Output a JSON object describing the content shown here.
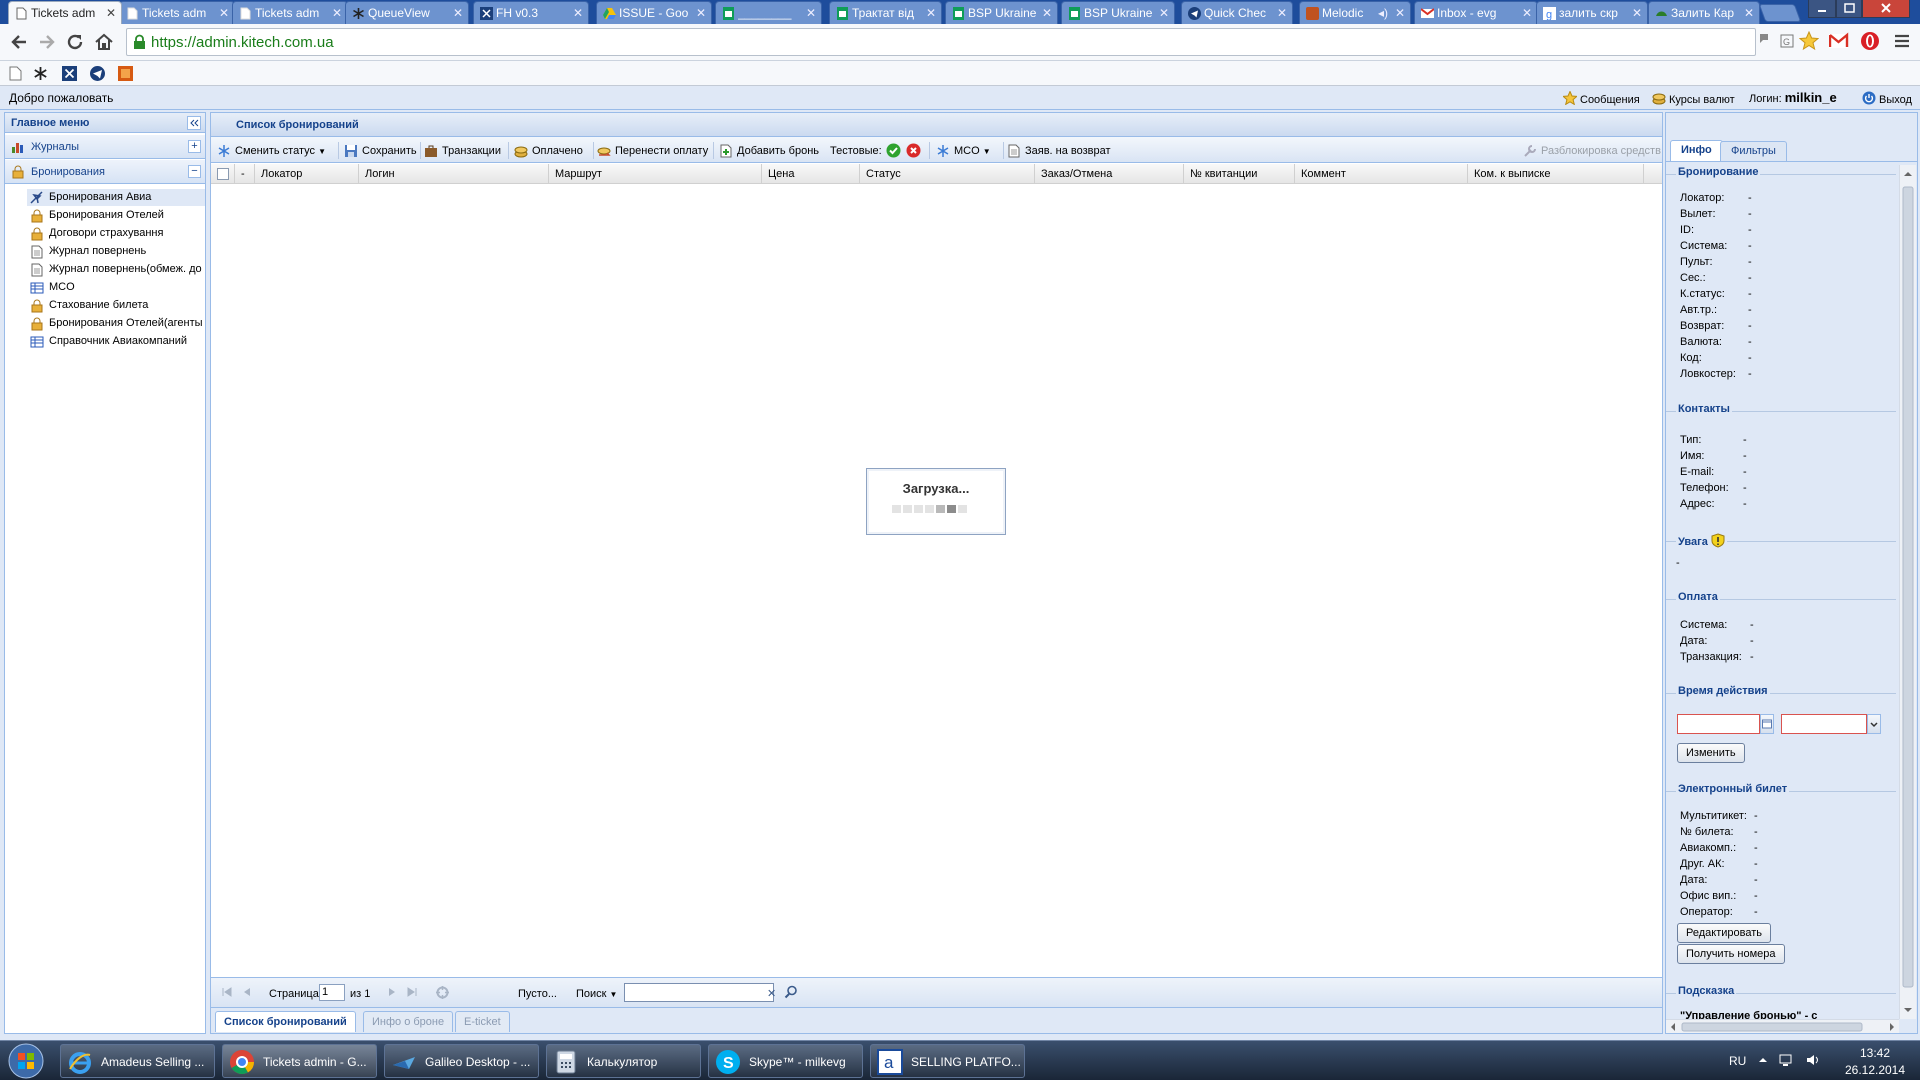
{
  "browser": {
    "tabs": [
      {
        "title": "Tickets adm",
        "active": true
      },
      {
        "title": "Tickets adm"
      },
      {
        "title": "Tickets adm"
      },
      {
        "title": "QueueView"
      },
      {
        "title": "FH v0.3"
      },
      {
        "title": "ISSUE - Goo"
      },
      {
        "title": "________"
      },
      {
        "title": "Трактат від"
      },
      {
        "title": "BSP Ukraine"
      },
      {
        "title": "BSP Ukraine"
      },
      {
        "title": "Quick Chec"
      },
      {
        "title": "Melodic"
      },
      {
        "title": "Inbox - evg"
      },
      {
        "title": "залить скр"
      },
      {
        "title": "Залить Кар"
      }
    ],
    "url": "https://admin.kitech.com.ua"
  },
  "app": {
    "welcome": "Добро пожаловать",
    "header": {
      "messages": "Сообщения",
      "rates": "Курсы валют",
      "login_label": "Логин:",
      "login_user": "milkin_e",
      "logout": "Выход"
    },
    "west": {
      "title": "Главное меню",
      "journals": "Журналы",
      "bookings": "Бронирования",
      "items": [
        "Бронирования Авиа",
        "Бронирования Отелей",
        "Договори страхування",
        "Журнал повернень",
        "Журнал повернень(обмеж. до",
        "MCO",
        "Стахование билета",
        "Бронирования Отелей(агенты",
        "Справочник Авиакомпаний"
      ]
    },
    "center": {
      "title": "Список бронирований",
      "toolbar": {
        "change_status": "Сменить статус",
        "save": "Сохранить",
        "transactions": "Транзакции",
        "paid": "Оплачено",
        "transfer_payment": "Перенести оплату",
        "add_booking": "Добавить бронь",
        "test_label": "Тестовые:",
        "mco": "MCO",
        "refund_request": "Заяв. на возврат",
        "unlock_funds": "Разблокировка средств"
      },
      "columns": [
        "-",
        "Локатор",
        "Логин",
        "Маршрут",
        "Цена",
        "Статус",
        "Заказ/Отмена",
        "№ квитанции",
        "Коммент",
        "Ком. к выписке"
      ],
      "loading": "Загрузка...",
      "pager": {
        "page_label": "Страница",
        "page_value": "1",
        "of": "из 1",
        "empty": "Пусто...",
        "search": "Поиск"
      },
      "bottom_tabs": [
        "Список бронирований",
        "Инфо о броне",
        "E-ticket"
      ]
    },
    "east": {
      "tabs": [
        "Инфо",
        "Фильтры"
      ],
      "booking": {
        "title": "Бронирование",
        "rows": [
          [
            "Локатор:",
            "-"
          ],
          [
            "Вылет:",
            "-"
          ],
          [
            "ID:",
            "-"
          ],
          [
            "Система:",
            "-"
          ],
          [
            "Пульт:",
            "-"
          ],
          [
            "Сес.:",
            "-"
          ],
          [
            "К.статус:",
            "-"
          ],
          [
            "Авт.тр.:",
            "-"
          ],
          [
            "Возврат:",
            "-"
          ],
          [
            "Валюта:",
            "-"
          ],
          [
            "Код:",
            "-"
          ],
          [
            "Ловкостер:",
            "-"
          ]
        ]
      },
      "contacts": {
        "title": "Контакты",
        "rows": [
          [
            "Тип:",
            "-"
          ],
          [
            "Имя:",
            "-"
          ],
          [
            "E-mail:",
            "-"
          ],
          [
            "Телефон:",
            "-"
          ],
          [
            "Адрес:",
            "-"
          ]
        ]
      },
      "attention": {
        "title": "Увага",
        "value": "-"
      },
      "payment": {
        "title": "Оплата",
        "rows": [
          [
            "Система:",
            "-"
          ],
          [
            "Дата:",
            "-"
          ],
          [
            "Транзакция:",
            "-"
          ]
        ]
      },
      "validity": {
        "title": "Время действия",
        "change_button": "Изменить"
      },
      "eticket": {
        "title": "Электронный билет",
        "rows": [
          [
            "Мультитикет:",
            "-"
          ],
          [
            "№ билета:",
            "-"
          ],
          [
            "Авиакомп.:",
            "-"
          ],
          [
            "Друг. АК:",
            "-"
          ],
          [
            "Дата:",
            "-"
          ],
          [
            "Офис вип.:",
            "-"
          ],
          [
            "Оператор:",
            "-"
          ]
        ],
        "edit_button": "Редактировать",
        "numbers_button": "Получить номера"
      },
      "hint": {
        "title": "Подсказка",
        "text": "\"Управление бронью\" - с"
      }
    }
  },
  "taskbar": {
    "items": [
      "Amadeus Selling ...",
      "Tickets admin - G...",
      "Galileo Desktop - ...",
      "Калькулятор",
      "Skype™ - milkevg",
      "SELLING PLATFO..."
    ],
    "lang": "RU",
    "time": "13:42",
    "date": "26.12.2014"
  },
  "colors": {
    "accent": "#15428b",
    "panel_bg": "#dfe8f6",
    "border": "#99bbe8",
    "url_green": "#1a7d1a"
  }
}
